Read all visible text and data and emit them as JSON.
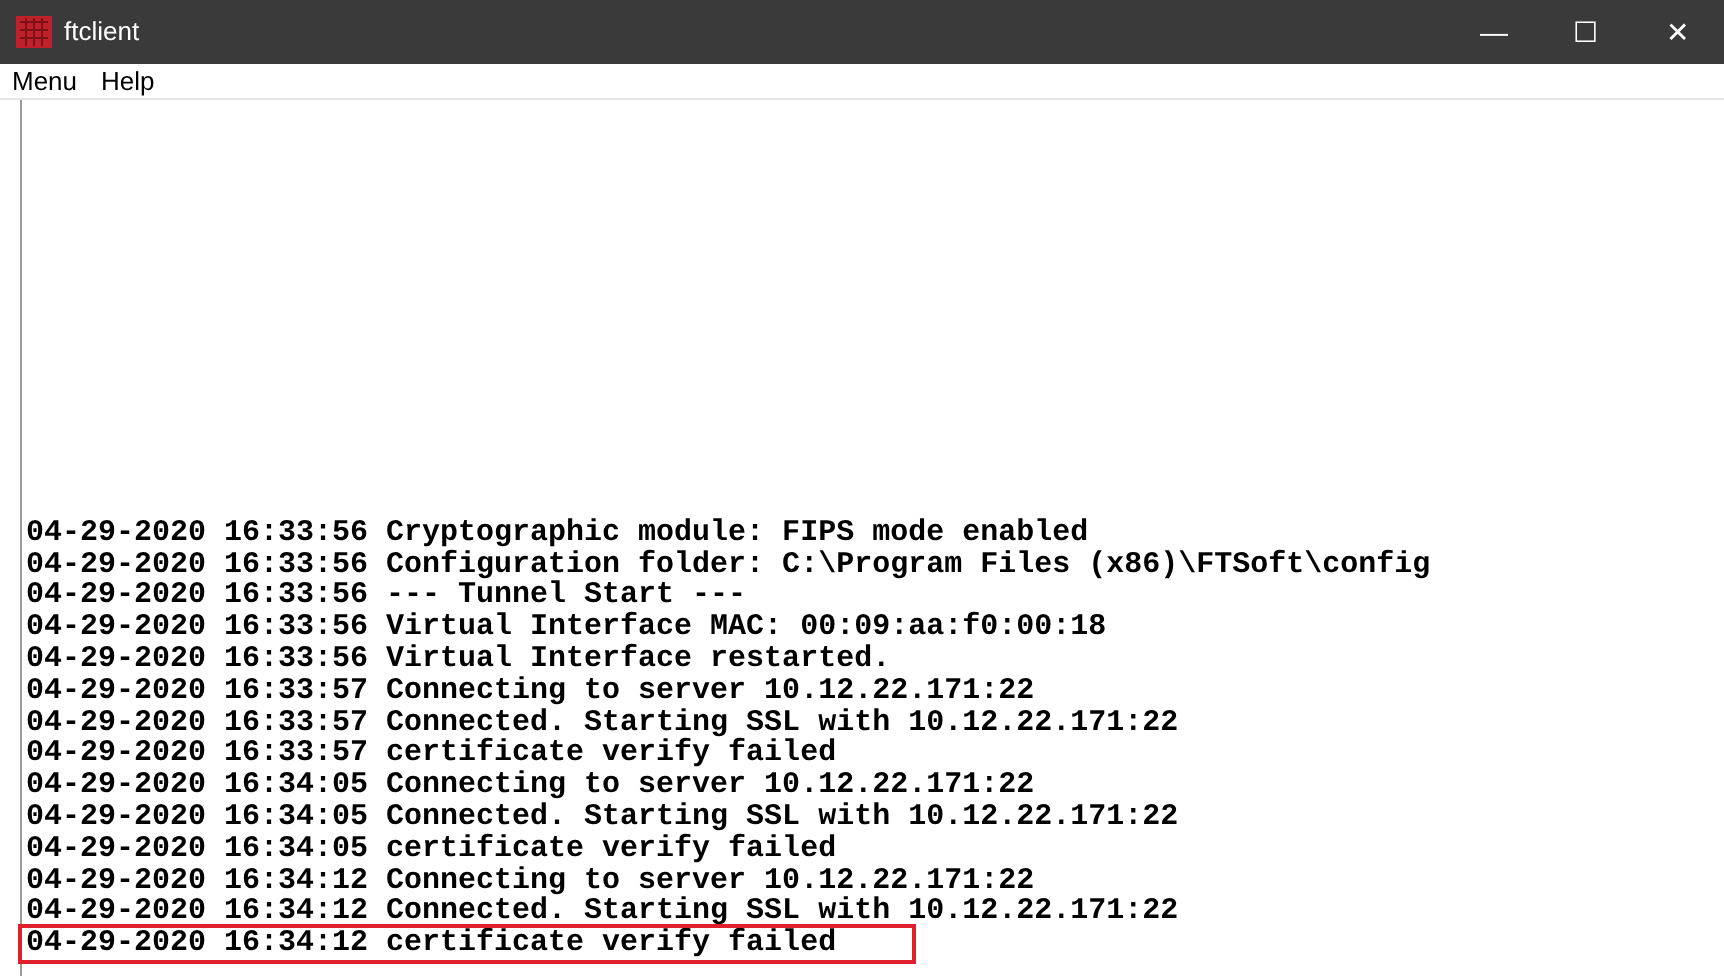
{
  "window": {
    "title": "ftclient",
    "controls": [
      "—",
      "☐",
      "✕"
    ]
  },
  "menu": [
    "Menu",
    "Help"
  ],
  "log": [
    {
      "text": "04-29-2020 16:33:56 Cryptographic module: FIPS mode enabled",
      "highlighted": false
    },
    {
      "text": "04-29-2020 16:33:56 Configuration folder: C:\\Program Files (x86)\\FTSoft\\config",
      "highlighted": false
    },
    {
      "text": "04-29-2020 16:33:56 --- Tunnel Start ---",
      "highlighted": false
    },
    {
      "text": "04-29-2020 16:33:56 Virtual Interface MAC: 00:09:aa:f0:00:18",
      "highlighted": false
    },
    {
      "text": "04-29-2020 16:33:56 Virtual Interface restarted.",
      "highlighted": false
    },
    {
      "text": "04-29-2020 16:33:57 Connecting to server 10.12.22.171:22",
      "highlighted": false
    },
    {
      "text": "04-29-2020 16:33:57 Connected. Starting SSL with 10.12.22.171:22",
      "highlighted": false
    },
    {
      "text": "04-29-2020 16:33:57 certificate verify failed",
      "highlighted": false
    },
    {
      "text": "04-29-2020 16:34:05 Connecting to server 10.12.22.171:22",
      "highlighted": false
    },
    {
      "text": "04-29-2020 16:34:05 Connected. Starting SSL with 10.12.22.171:22",
      "highlighted": false
    },
    {
      "text": "04-29-2020 16:34:05 certificate verify failed",
      "highlighted": false
    },
    {
      "text": "04-29-2020 16:34:12 Connecting to server 10.12.22.171:22",
      "highlighted": false
    },
    {
      "text": "04-29-2020 16:34:12 Connected. Starting SSL with 10.12.22.171:22",
      "highlighted": false
    },
    {
      "text": "04-29-2020 16:34:12 certificate verify failed",
      "highlighted": true
    }
  ]
}
